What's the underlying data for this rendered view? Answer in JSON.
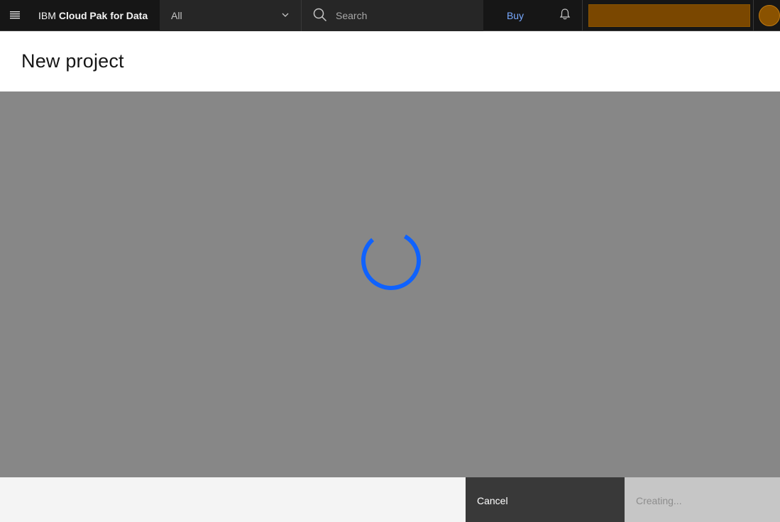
{
  "header": {
    "brand_prefix": "IBM",
    "brand_product": "Cloud Pak for Data",
    "scope_selected": "All",
    "search_placeholder": "Search",
    "buy_label": "Buy",
    "icons": [
      "menu-icon",
      "chevron-down-icon",
      "search-icon",
      "bell-icon"
    ],
    "colors": {
      "background": "#161616",
      "buy_link": "#78a9ff",
      "account": "#7a4700"
    }
  },
  "page": {
    "title": "New project"
  },
  "overlay": {
    "state": "loading",
    "spinner_color": "#0f62fe"
  },
  "footer": {
    "cancel_label": "Cancel",
    "primary_label": "Creating..."
  }
}
